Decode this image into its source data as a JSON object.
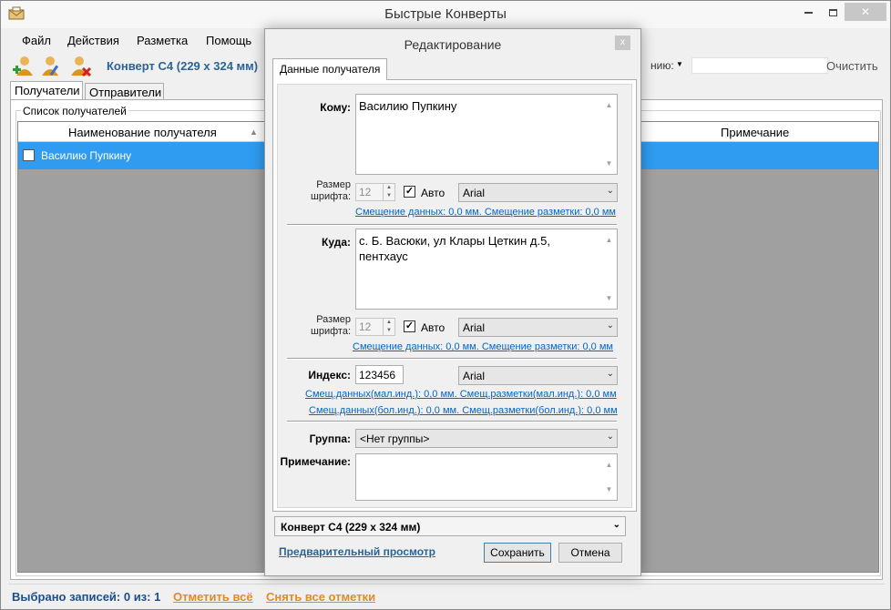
{
  "app": {
    "title": "Быстрые Конверты"
  },
  "menu": [
    "Файл",
    "Действия",
    "Разметка",
    "Помощь"
  ],
  "toolbar": {
    "envelope": "Конверт С4 (229 x 324 мм)",
    "filter_label": "нию:",
    "clear": "Очистить"
  },
  "tabs": [
    "Получатели",
    "Отправители"
  ],
  "list": {
    "group_label": "Список получателей",
    "col_name": "Наименование получателя",
    "col_note": "Примечание",
    "rows": [
      {
        "name": "Василию Пупкину"
      }
    ]
  },
  "status": {
    "selected": "Выбрано записей: 0  из: 1",
    "mark_all": "Отметить всё",
    "unmark_all": "Снять все отметки"
  },
  "dialog": {
    "title": "Редактирование",
    "close": "x",
    "tab": "Данные получателя",
    "to_label": "Кому:",
    "to_value": "Василию Пупкину",
    "font_size_label_1": "Размер",
    "font_size_label_2": "шрифта:",
    "font_size": "12",
    "auto_label": "Авто",
    "font": "Arial",
    "offset_link": "Смещение данных: 0,0 мм. Смещение разметки: 0,0 мм",
    "where_label": "Куда:",
    "where_value": "с. Б. Васюки, ул Клары Цеткин д.5, пентхаус",
    "index_label": "Индекс:",
    "index_value": "123456",
    "index_offset_small": "Смещ.данных(мал.инд.): 0,0 мм. Смещ.разметки(мал.инд.): 0,0 мм",
    "index_offset_big": "Смещ.данных(бол.инд.): 0,0 мм. Смещ.разметки(бол.инд.): 0,0 мм",
    "group_label": "Группа:",
    "group_value": "<Нет группы>",
    "note_label": "Примечание:",
    "envelope": "Конверт С4 (229 x 324 мм)",
    "preview": "Предварительный просмотр",
    "save": "Сохранить",
    "cancel": "Отмена"
  }
}
